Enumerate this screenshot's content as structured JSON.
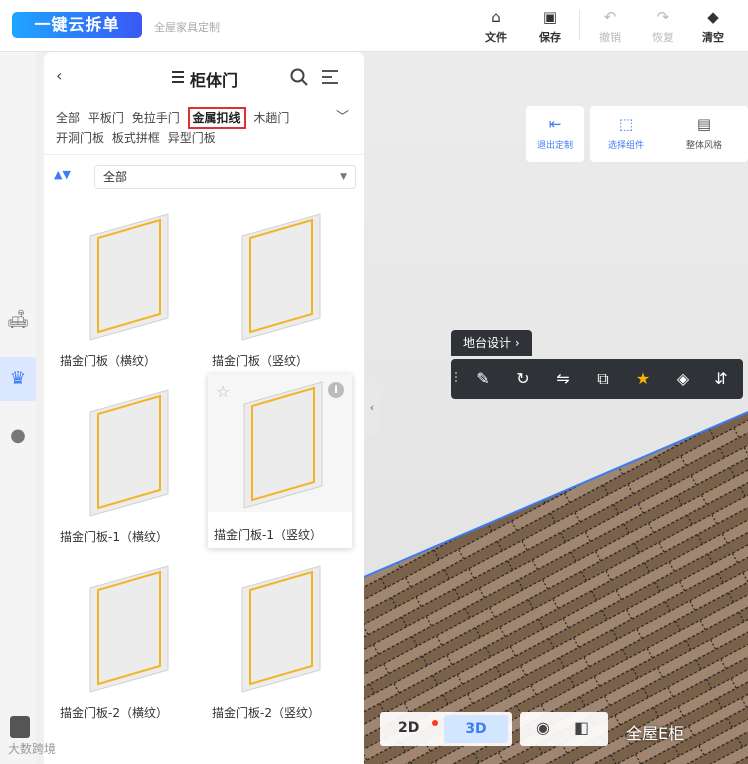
{
  "app": {
    "logo_text": "一键云拆单",
    "subtitle": "全屋家具定制"
  },
  "toolbar": {
    "file": "文件",
    "save": "保存",
    "undo": "撤销",
    "redo": "恢复",
    "clear": "清空"
  },
  "panel": {
    "title": "柜体门",
    "categories": [
      "全部",
      "平板门",
      "免拉手门",
      "金属扣线",
      "木趟门",
      "开洞门板",
      "板式拼框",
      "异型门板"
    ],
    "active_category": "金属扣线",
    "filter_value": "全部",
    "items": [
      {
        "name": "描金门板（横纹）"
      },
      {
        "name": "描金门板（竖纹）"
      },
      {
        "name": "描金门板-1（横纹）"
      },
      {
        "name": "描金门板-1（竖纹）"
      },
      {
        "name": "描金门板-2（横纹）"
      },
      {
        "name": "描金门板-2（竖纹）"
      }
    ]
  },
  "viewport_tools": {
    "exit_custom": "退出定制",
    "select_component": "选择组件",
    "overall_style": "整体风格"
  },
  "context": {
    "design_label": "地台设计"
  },
  "view_switch": {
    "mode_2d": "2D",
    "mode_3d": "3D",
    "active": "3D"
  },
  "watermarks": {
    "brand": "全屋E柜",
    "left": "大数跨境"
  },
  "colors": {
    "accent": "#3f7cf4",
    "highlight_border": "#e03030",
    "gold_trim": "#f2b52a",
    "star": "#f7b500",
    "dark_bar": "#2f3338"
  }
}
